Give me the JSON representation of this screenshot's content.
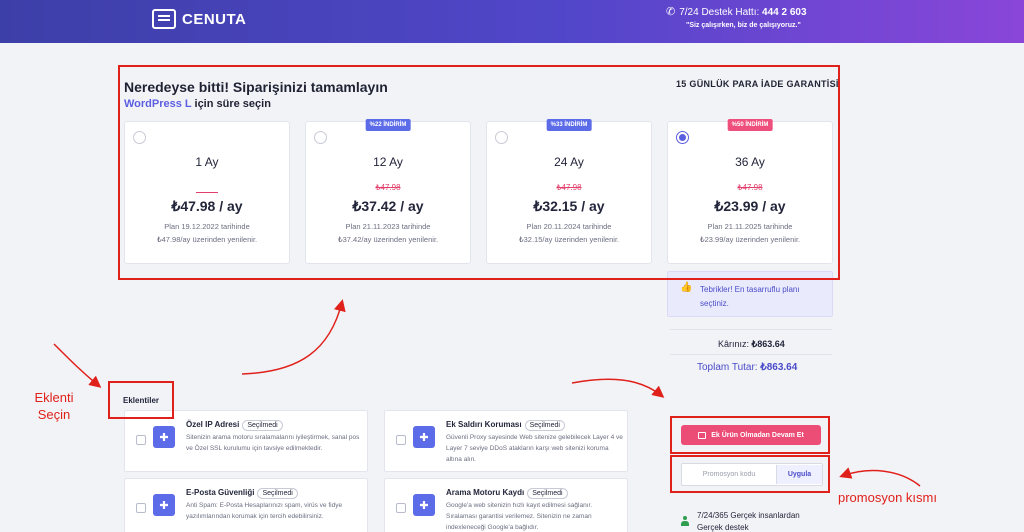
{
  "header": {
    "brand": "CENUTA",
    "support_label": "7/24 Destek Hattı: ",
    "support_phone": "444 2 603",
    "support_sub": "\"Siz çalışırken, biz de çalışıyoruz.\"",
    "gradient": [
      "#3d3fa8",
      "#8a46d9"
    ]
  },
  "plan": {
    "title": "Neredeyse bitti! Siparişinizi tamamlayın",
    "subtitle_product": "WordPress L",
    "subtitle_rest": " için süre seçin",
    "guarantee": "15 GÜNLÜK PARA İADE GARANTİSİ",
    "cards": [
      {
        "badge": "",
        "period": "1 Ay",
        "old_price": "",
        "price": "₺47.98 / ay",
        "renew1": "Plan 19.12.2022 tarihinde",
        "renew2": "₺47.98/ay üzerinden yenilenir.",
        "selected": false
      },
      {
        "badge": "%22 İNDİRİM",
        "period": "12 Ay",
        "old_price": "₺47.98",
        "price": "₺37.42 / ay",
        "renew1": "Plan 21.11.2023 tarihinde",
        "renew2": "₺37.42/ay üzerinden yenilenir.",
        "selected": false
      },
      {
        "badge": "%33 İNDİRİM",
        "period": "24 Ay",
        "old_price": "₺47.98",
        "price": "₺32.15 / ay",
        "renew1": "Plan 20.11.2024 tarihinde",
        "renew2": "₺32.15/ay üzerinden yenilenir.",
        "selected": false
      },
      {
        "badge": "%50 İNDİRİM",
        "period": "36 Ay",
        "old_price": "₺47.98",
        "price": "₺23.99 / ay",
        "renew1": "Plan 21.11.2025 tarihinde",
        "renew2": "₺23.99/ay üzerinden yenilenir.",
        "selected": true
      }
    ]
  },
  "summary": {
    "congrats": "Tebrikler! En tasarruflu planı seçtiniz.",
    "savings_label": "Kârınız: ",
    "savings_value": "₺863.64",
    "total_label": "Toplam Tutar: ",
    "total_value": "₺863.64",
    "continue_button": "Ek Ürün Olmadan Devam Et",
    "promo_placeholder": "Promosyon kodu",
    "apply_button": "Uygula",
    "support_line1": "7/24/365 Gerçek insanlardan",
    "support_line2": "Gerçek destek"
  },
  "addons": {
    "title": "Eklentiler",
    "status": "Seçilmedi",
    "items": [
      {
        "name": "Özel IP Adresi",
        "desc": "Sitenizin arama motoru sıralamalarını iyileştirmek, sanal pos ve Özel SSL kurulumu için tavsiye edilmektedir."
      },
      {
        "name": "Ek Saldırı Koruması",
        "desc": "Güvenli Proxy sayesinde Web sitenize gelebilecek Layer 4 ve Layer 7 seviye DDoS atakların karşı web sitenizi koruma altına alın."
      },
      {
        "name": "E-Posta Güvenliği",
        "desc": "Anti Spam: E-Posta Hesaplarınızı spam, virüs ve fidye yazılımlarından korumak için tercih edebilirsiniz."
      },
      {
        "name": "Arama Motoru Kaydı",
        "desc": "Google'a web sitenizin hızlı kayıt edilmesi sağlanır. Sıralaması garantisi verilemez. Sitenizin ne zaman indexleneceği Google'a bağlıdır."
      }
    ]
  },
  "annotations": {
    "addon_note_line1": "Eklenti",
    "addon_note_line2": "Seçin",
    "promo_note": "promosyon kısmı",
    "color": "#e0211b"
  }
}
